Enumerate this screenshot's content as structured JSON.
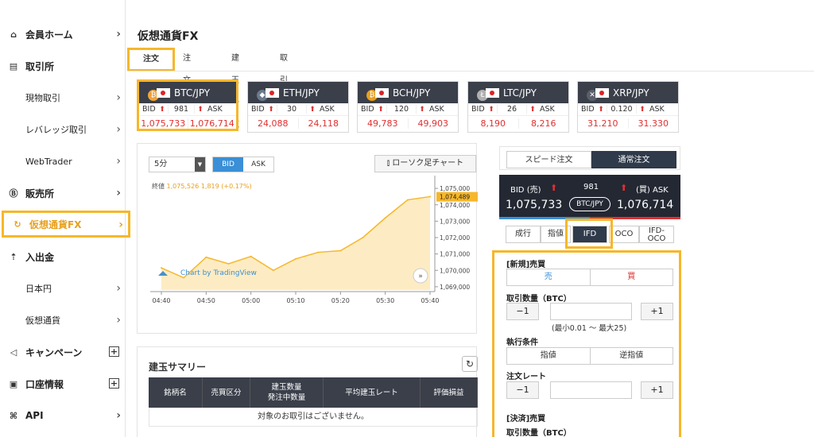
{
  "sidebar": {
    "items": [
      {
        "label": "会員ホーム",
        "icon": "home-icon",
        "glyph": "⌂"
      },
      {
        "label": "取引所",
        "icon": "exchange-icon",
        "glyph": "▤"
      },
      {
        "label": "現物取引"
      },
      {
        "label": "レバレッジ取引"
      },
      {
        "label": "WebTrader"
      },
      {
        "label": "販売所",
        "icon": "bitcoin-icon",
        "glyph": "Ⓑ"
      },
      {
        "label": "仮想通貨FX",
        "icon": "fx-icon",
        "glyph": "↻"
      },
      {
        "label": "入出金",
        "icon": "deposit-icon",
        "glyph": "⇡"
      },
      {
        "label": "日本円"
      },
      {
        "label": "仮想通貨"
      },
      {
        "label": "キャンペーン",
        "icon": "megaphone-icon",
        "glyph": "◁"
      },
      {
        "label": "口座情報",
        "icon": "account-icon",
        "glyph": "▣"
      },
      {
        "label": "API",
        "icon": "api-icon",
        "glyph": "⌘"
      }
    ]
  },
  "page": {
    "title": "仮想通貨FX"
  },
  "tabs": [
    "注文",
    "注文一覧",
    "建玉一覧",
    "取引履歴"
  ],
  "pairs": [
    {
      "name": "BTC/JPY",
      "coin_glyph": "₿",
      "coin_color": "#f2a33a",
      "bid_label": "BID",
      "ask_label": "ASK",
      "spread": "981",
      "bid": "1,075,733",
      "ask": "1,076,714"
    },
    {
      "name": "ETH/JPY",
      "coin_glyph": "◆",
      "coin_color": "#6b7a8c",
      "bid_label": "BID",
      "ask_label": "ASK",
      "spread": "30",
      "bid": "24,088",
      "ask": "24,118"
    },
    {
      "name": "BCH/JPY",
      "coin_glyph": "₿",
      "coin_color": "#e8a01c",
      "bid_label": "BID",
      "ask_label": "ASK",
      "spread": "120",
      "bid": "49,783",
      "ask": "49,903"
    },
    {
      "name": "LTC/JPY",
      "coin_glyph": "Ł",
      "coin_color": "#b0b0b0",
      "bid_label": "BID",
      "ask_label": "ASK",
      "spread": "26",
      "bid": "8,190",
      "ask": "8,216"
    },
    {
      "name": "XRP/JPY",
      "coin_glyph": "✕",
      "coin_color": "#5a5f6a",
      "bid_label": "BID",
      "ask_label": "ASK",
      "spread": "0.120",
      "bid": "31.210",
      "ask": "31.330"
    }
  ],
  "chart_controls": {
    "interval": "5分",
    "bid": "BID",
    "ask": "ASK",
    "candle_button": "ローソク足チャート",
    "closing_label": "終値",
    "closing_value": "1,075,526",
    "closing_change": "1,819 (+0.17%)",
    "watermark": "Chart by TradingView",
    "current_price_label": "1,074,489"
  },
  "chart_data": {
    "type": "area",
    "x": [
      "04:40",
      "04:45",
      "04:50",
      "04:55",
      "05:00",
      "05:05",
      "05:10",
      "05:15",
      "05:20",
      "05:25",
      "05:30",
      "05:35",
      "05:40"
    ],
    "values": [
      1070150,
      1069550,
      1070800,
      1070400,
      1070850,
      1070000,
      1070700,
      1071100,
      1071200,
      1072000,
      1073200,
      1074300,
      1074500
    ],
    "xticks": [
      "04:40",
      "04:50",
      "05:00",
      "05:10",
      "05:20",
      "05:30",
      "05:40"
    ],
    "yticks": [
      "1,075,000",
      "1,074,000",
      "1,073,000",
      "1,072,000",
      "1,071,000",
      "1,070,000",
      "1,069,000"
    ],
    "ylim": [
      1068800,
      1075200
    ],
    "colors": {
      "line": "#f6b72b",
      "fill": "#fde9b8"
    }
  },
  "summary": {
    "title": "建玉サマリー",
    "columns": [
      "銘柄名",
      "売買区分",
      "建玉数量\n発注中数量",
      "平均建玉レート",
      "評価損益"
    ],
    "empty": "対象のお取引はございません。"
  },
  "order": {
    "mode_tabs": [
      "スピード注文",
      "通常注文"
    ],
    "quote": {
      "bid_label": "BID (売)",
      "ask_label": "(買) ASK",
      "spread": "981",
      "pair": "BTC/JPY",
      "bid": "1,075,733",
      "ask": "1,076,714"
    },
    "types": [
      "成行",
      "指値",
      "IFD",
      "OCO",
      "IFD-OCO"
    ],
    "form": {
      "new_label": "[新規]売買",
      "sell": "売",
      "buy": "買",
      "qty_label": "取引数量（BTC）",
      "minus": "−1",
      "plus": "+1",
      "qty_note": "(最小0.01 〜 最大25)",
      "cond_label": "執行条件",
      "limit": "指値",
      "stop": "逆指値",
      "rate_label": "注文レート",
      "settle_label": "[決済]売買",
      "settle_qty_label": "取引数量（BTC）"
    }
  },
  "colors": {
    "highlight": "#f6b72b",
    "dark": "#3a3f4a",
    "down": "#e03030",
    "accent": "#3a8fd6"
  }
}
